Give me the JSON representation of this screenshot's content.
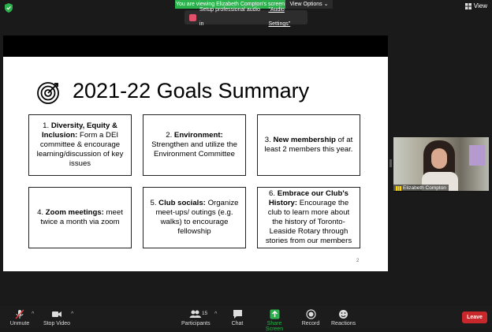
{
  "topbar": {
    "viewing_banner": "You are viewing Elizabeth Compton's screen",
    "view_options": "View Options",
    "view_label": "View"
  },
  "audio_toast": {
    "prefix": "Setup professional audio in",
    "link": "\"Audio Settings\""
  },
  "slide": {
    "title": "2021-22 Goals Summary",
    "page_number": "2",
    "goals": [
      {
        "num": "1.",
        "bold": "Diversity, Equity & Inclusion:",
        "text": "Form a DEI committee & encourage learning/discussion of key issues"
      },
      {
        "num": "2.",
        "bold": "Environment:",
        "text": "Strengthen and utilize the Environment Committee"
      },
      {
        "num": "3.",
        "bold": "New membership",
        "text": "of at least 2 members this year."
      },
      {
        "num": "4.",
        "bold": "Zoom meetings:",
        "text": "meet twice a month via zoom"
      },
      {
        "num": "5.",
        "bold": "Club socials:",
        "text": "Organize meet-ups/ outings (e.g. walks) to encourage fellowship"
      },
      {
        "num": "6.",
        "bold": "Embrace our Club's History:",
        "text": "Encourage the club to learn more about the history of Toronto-Leaside Rotary through stories from our members"
      }
    ]
  },
  "participant_video": {
    "name": "Elizabeth Compton"
  },
  "toolbar": {
    "unmute": "Unmute",
    "stop_video": "Stop Video",
    "participants": "Participants",
    "participants_count": "15",
    "chat": "Chat",
    "share_screen": "Share Screen",
    "record": "Record",
    "reactions": "Reactions",
    "leave": "Leave"
  },
  "colors": {
    "share_green": "#2bb24c",
    "leave_red": "#c8282b",
    "toolbar_bg": "#1c1c1c"
  }
}
